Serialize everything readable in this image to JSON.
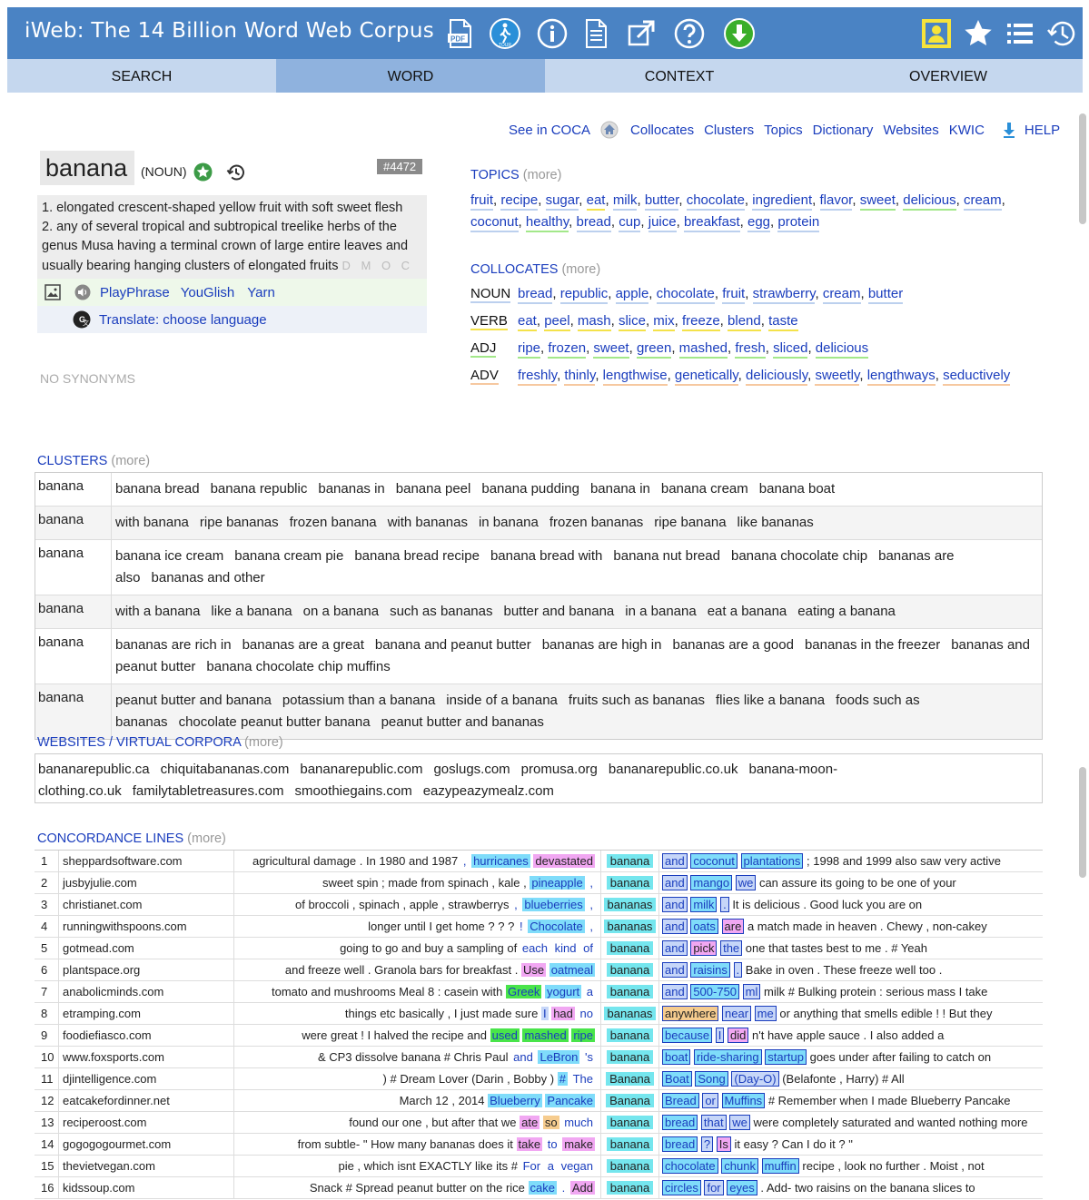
{
  "header": {
    "title": "iWeb: The 14 Billion Word Web Corpus",
    "pdf_label": "PDF",
    "tour_label": "TOUR"
  },
  "tabs": [
    {
      "label": "SEARCH"
    },
    {
      "label": "WORD"
    },
    {
      "label": "CONTEXT"
    },
    {
      "label": "OVERVIEW"
    }
  ],
  "toplinks": {
    "coca": "See in COCA",
    "collocates": "Collocates",
    "clusters": "Clusters",
    "topics": "Topics",
    "dictionary": "Dictionary",
    "websites": "Websites",
    "kwic": "KWIC",
    "help": "HELP"
  },
  "word": {
    "headword": "banana",
    "pos": "(NOUN)",
    "rank": "#4472",
    "def1": "1. elongated crescent-shaped yellow fruit with soft sweet flesh",
    "def2": "2. any of several tropical and subtropical treelike herbs of the genus Musa having a terminal crown of large entire leaves and usually bearing hanging clusters of elongated fruits",
    "dict_letters": "D M O C G",
    "playphrase": "PlayPhrase",
    "youglish": "YouGlish",
    "yarn": "Yarn",
    "translate": "Translate: choose language",
    "no_synonyms": "NO SYNONYMS"
  },
  "topics": {
    "title": "TOPICS",
    "more": "(more)",
    "words": [
      "fruit",
      "recipe",
      "sugar",
      "eat",
      "milk",
      "butter",
      "chocolate",
      "ingredient",
      "flavor",
      "sweet",
      "delicious",
      "cream",
      "coconut",
      "healthy",
      "bread",
      "cup",
      "juice",
      "breakfast",
      "egg",
      "protein"
    ],
    "pos": [
      "n",
      "n",
      "n",
      "v",
      "n",
      "n",
      "n",
      "n",
      "n",
      "j",
      "j",
      "n",
      "n",
      "j",
      "n",
      "n",
      "n",
      "n",
      "n",
      "n"
    ]
  },
  "collocates": {
    "title": "COLLOCATES",
    "more": "(more)",
    "noun_label": "NOUN",
    "noun": [
      "bread",
      "republic",
      "apple",
      "chocolate",
      "fruit",
      "strawberry",
      "cream",
      "butter"
    ],
    "verb_label": "VERB",
    "verb": [
      "eat",
      "peel",
      "mash",
      "slice",
      "mix",
      "freeze",
      "blend",
      "taste"
    ],
    "adj_label": "ADJ",
    "adj": [
      "ripe",
      "frozen",
      "sweet",
      "green",
      "mashed",
      "fresh",
      "sliced",
      "delicious"
    ],
    "adv_label": "ADV",
    "adv": [
      "freshly",
      "thinly",
      "lengthwise",
      "genetically",
      "deliciously",
      "sweetly",
      "lengthways",
      "seductively"
    ]
  },
  "clusters": {
    "title": "CLUSTERS",
    "more": "(more)",
    "rows": [
      {
        "key": "banana",
        "vals": [
          "banana bread",
          "banana republic",
          "bananas in",
          "banana peel",
          "banana pudding",
          "banana in",
          "banana cream",
          "banana boat"
        ]
      },
      {
        "key": "banana",
        "vals": [
          "with banana",
          "ripe bananas",
          "frozen banana",
          "with bananas",
          "in banana",
          "frozen bananas",
          "ripe banana",
          "like bananas"
        ]
      },
      {
        "key": "banana",
        "vals": [
          "banana ice cream",
          "banana cream pie",
          "banana bread recipe",
          "banana bread with",
          "banana nut bread",
          "banana chocolate chip",
          "bananas are also",
          "bananas and other"
        ]
      },
      {
        "key": "banana",
        "vals": [
          "with a banana",
          "like a banana",
          "on a banana",
          "such as bananas",
          "butter and banana",
          "in a banana",
          "eat a banana",
          "eating a banana"
        ]
      },
      {
        "key": "banana",
        "vals": [
          "bananas are rich in",
          "bananas are a great",
          "banana and peanut butter",
          "bananas are high in",
          "bananas are a good",
          "bananas in the freezer",
          "bananas and peanut butter",
          "banana chocolate chip muffins"
        ]
      },
      {
        "key": "banana",
        "vals": [
          "peanut butter and banana",
          "potassium than a banana",
          "inside of a banana",
          "fruits such as bananas",
          "flies like a banana",
          "foods such as bananas",
          "chocolate peanut butter banana",
          "peanut butter and bananas"
        ]
      }
    ]
  },
  "websites": {
    "title": "WEBSITES / VIRTUAL CORPORA",
    "more": "(more)",
    "items": [
      "bananarepublic.ca",
      "chiquitabananas.com",
      "bananarepublic.com",
      "goslugs.com",
      "promusa.org",
      "bananarepublic.co.uk",
      "banana-moon-clothing.co.uk",
      "familytabletreasures.com",
      "smoothiegains.com",
      "eazypeazymealz.com"
    ]
  },
  "concordance": {
    "title": "CONCORDANCE LINES",
    "more": "(more)",
    "rows": [
      {
        "n": "1",
        "src": "sheppardsoftware.com",
        "left_plain": "agricultural damage . In 1980 and 1987",
        "left_tokens": [
          {
            "t": ",",
            "c": "pl"
          },
          {
            "t": "hurricanes",
            "c": "nn"
          },
          {
            "t": "devastated",
            "c": "vb"
          }
        ],
        "kw": "banana",
        "right_tokens": [
          {
            "t": "and",
            "c": "bx"
          },
          {
            "t": "coconut",
            "c": "bx"
          },
          {
            "t": "plantations",
            "c": "bx"
          }
        ],
        "right_plain": "; 1998 and 1999 also saw very active"
      },
      {
        "n": "2",
        "src": "jusbyjulie.com",
        "left_plain": "sweet spin ; made from spinach , kale ,",
        "left_tokens": [
          {
            "t": "pineapple",
            "c": "nn"
          },
          {
            "t": ",",
            "c": "pl"
          }
        ],
        "kw": "banana",
        "right_tokens": [
          {
            "t": "and",
            "c": "bx"
          },
          {
            "t": "mango",
            "c": "bx"
          },
          {
            "t": "we",
            "c": "bx"
          }
        ],
        "right_plain": "can assure its going to be one of your"
      },
      {
        "n": "3",
        "src": "christianet.com",
        "left_plain": "of broccoli , spinach , apple , strawberrys",
        "left_tokens": [
          {
            "t": ",",
            "c": "pl"
          },
          {
            "t": "blueberries",
            "c": "nn"
          },
          {
            "t": ",",
            "c": "pl"
          }
        ],
        "kw": "bananas",
        "right_tokens": [
          {
            "t": "and",
            "c": "bx"
          },
          {
            "t": "milk",
            "c": "bx"
          },
          {
            "t": ".",
            "c": "bx"
          }
        ],
        "right_plain": "It is delicious . Good luck you are on"
      },
      {
        "n": "4",
        "src": "runningwithspoons.com",
        "left_plain": "longer until I get home ? ? ?",
        "left_tokens": [
          {
            "t": "!",
            "c": "pl"
          },
          {
            "t": "Chocolate",
            "c": "nn"
          },
          {
            "t": ",",
            "c": "pl"
          }
        ],
        "kw": "bananas",
        "right_tokens": [
          {
            "t": "and",
            "c": "bx"
          },
          {
            "t": "oats",
            "c": "bx"
          },
          {
            "t": "are",
            "c": "bx"
          }
        ],
        "right_plain": "a match made in heaven . Chewy , non-cakey"
      },
      {
        "n": "5",
        "src": "gotmead.com",
        "left_plain": "going to go and buy a sampling of",
        "left_tokens": [
          {
            "t": "each",
            "c": "pl"
          },
          {
            "t": "kind",
            "c": "pl"
          },
          {
            "t": "of",
            "c": "pl"
          }
        ],
        "kw": "banana",
        "right_tokens": [
          {
            "t": "and",
            "c": "bx"
          },
          {
            "t": "pick",
            "c": "bx"
          },
          {
            "t": "the",
            "c": "bx"
          }
        ],
        "right_plain": "one that tastes best to me . # Yeah"
      },
      {
        "n": "6",
        "src": "plantspace.org",
        "left_plain": "and freeze well . Granola bars for breakfast .",
        "left_tokens": [
          {
            "t": "Use",
            "c": "vb"
          },
          {
            "t": "oatmeal",
            "c": "nn"
          }
        ],
        "kw": "banana",
        "right_tokens": [
          {
            "t": "and",
            "c": "bx"
          },
          {
            "t": "raisins",
            "c": "bx"
          },
          {
            "t": ".",
            "c": "bx"
          }
        ],
        "right_plain": "Bake in oven . These freeze well too ."
      },
      {
        "n": "7",
        "src": "anabolicminds.com",
        "left_plain": "tomato and mushrooms Meal 8 : casein with",
        "left_tokens": [
          {
            "t": "Greek",
            "c": "jj"
          },
          {
            "t": "yogurt",
            "c": "nn"
          },
          {
            "t": "a",
            "c": "pl"
          }
        ],
        "kw": "banana",
        "right_tokens": [
          {
            "t": "and",
            "c": "bx"
          },
          {
            "t": "500-750",
            "c": "bx"
          },
          {
            "t": "ml",
            "c": "bx"
          }
        ],
        "right_plain": "milk # Bulking protein : serious mass I take"
      },
      {
        "n": "8",
        "src": "etramping.com",
        "left_plain": "things etc basically , I just made sure",
        "left_tokens": [
          {
            "t": "I",
            "c": "oth"
          },
          {
            "t": "had",
            "c": "vb"
          },
          {
            "t": "no",
            "c": "pl"
          }
        ],
        "kw": "bananas",
        "right_tokens": [
          {
            "t": "anywhere",
            "c": "bx"
          },
          {
            "t": "near",
            "c": "bx"
          },
          {
            "t": "me",
            "c": "bx"
          }
        ],
        "right_plain": "or anything that smells edible ! ! But they"
      },
      {
        "n": "9",
        "src": "foodiefiasco.com",
        "left_plain": "were great ! I halved the recipe and",
        "left_tokens": [
          {
            "t": "used",
            "c": "jj"
          },
          {
            "t": "mashed",
            "c": "jj"
          },
          {
            "t": "ripe",
            "c": "jj"
          }
        ],
        "kw": "banana",
        "right_tokens": [
          {
            "t": "because",
            "c": "bx"
          },
          {
            "t": "I",
            "c": "bx"
          },
          {
            "t": "did",
            "c": "bx"
          }
        ],
        "right_plain": "n't have apple sauce . I also added a"
      },
      {
        "n": "10",
        "src": "www.foxsports.com",
        "left_plain": "& CP3 dissolve banana # Chris Paul",
        "left_tokens": [
          {
            "t": "and",
            "c": "pl"
          },
          {
            "t": "LeBron",
            "c": "nn"
          },
          {
            "t": "'s",
            "c": "pl"
          }
        ],
        "kw": "banana",
        "right_tokens": [
          {
            "t": "boat",
            "c": "bx"
          },
          {
            "t": "ride-sharing",
            "c": "bx"
          },
          {
            "t": "startup",
            "c": "bx"
          }
        ],
        "right_plain": "goes under after failing to catch on"
      },
      {
        "n": "11",
        "src": "djintelligence.com",
        "left_plain": ") # Dream Lover (Darin , Bobby )",
        "left_tokens": [
          {
            "t": "#",
            "c": "nn"
          },
          {
            "t": "The",
            "c": "pl"
          }
        ],
        "kw": "Banana",
        "right_tokens": [
          {
            "t": "Boat",
            "c": "bx"
          },
          {
            "t": "Song",
            "c": "bx"
          },
          {
            "t": "(Day-O)",
            "c": "bx"
          }
        ],
        "right_plain": "(Belafonte , Harry) # All"
      },
      {
        "n": "12",
        "src": "eatcakefordinner.net",
        "left_plain": "March 12 , 2014",
        "left_tokens": [
          {
            "t": "Blueberry",
            "c": "nn"
          },
          {
            "t": "Pancake",
            "c": "nn"
          }
        ],
        "kw": "Banana",
        "right_tokens": [
          {
            "t": "Bread",
            "c": "bx"
          },
          {
            "t": "or",
            "c": "bx"
          },
          {
            "t": "Muffins",
            "c": "bx"
          }
        ],
        "right_plain": "# Remember when I made Blueberry Pancake"
      },
      {
        "n": "13",
        "src": "reciperoost.com",
        "left_plain": "found our one , but after that we",
        "left_tokens": [
          {
            "t": "ate",
            "c": "vb"
          },
          {
            "t": "so",
            "c": "rb"
          },
          {
            "t": "much",
            "c": "pl"
          }
        ],
        "kw": "banana",
        "right_tokens": [
          {
            "t": "bread",
            "c": "bx"
          },
          {
            "t": "that",
            "c": "bx"
          },
          {
            "t": "we",
            "c": "bx"
          }
        ],
        "right_plain": "were completely saturated and wanted nothing more"
      },
      {
        "n": "14",
        "src": "gogogogourmet.com",
        "left_plain": "from subtle- \" How many bananas does it",
        "left_tokens": [
          {
            "t": "take",
            "c": "vb"
          },
          {
            "t": "to",
            "c": "pl"
          },
          {
            "t": "make",
            "c": "vb"
          }
        ],
        "kw": "banana",
        "right_tokens": [
          {
            "t": "bread",
            "c": "bx"
          },
          {
            "t": "?",
            "c": "bx"
          },
          {
            "t": "Is",
            "c": "bx"
          }
        ],
        "right_plain": "it easy ? Can I do it ? \""
      },
      {
        "n": "15",
        "src": "thevietvegan.com",
        "left_plain": "pie , which isnt EXACTLY like its #",
        "left_tokens": [
          {
            "t": "For",
            "c": "pl"
          },
          {
            "t": "a",
            "c": "pl"
          },
          {
            "t": "vegan",
            "c": "pl"
          }
        ],
        "kw": "banana",
        "right_tokens": [
          {
            "t": "chocolate",
            "c": "bx"
          },
          {
            "t": "chunk",
            "c": "bx"
          },
          {
            "t": "muffin",
            "c": "bx"
          }
        ],
        "right_plain": "recipe , look no further . Moist , not"
      },
      {
        "n": "16",
        "src": "kidssoup.com",
        "left_plain": "Snack # Spread peanut butter on the rice",
        "left_tokens": [
          {
            "t": "cake",
            "c": "nn"
          },
          {
            "t": ".",
            "c": "pl"
          },
          {
            "t": "Add",
            "c": "vb"
          }
        ],
        "kw": "banana",
        "right_tokens": [
          {
            "t": "circles",
            "c": "bx"
          },
          {
            "t": "for",
            "c": "bx"
          },
          {
            "t": "eyes",
            "c": "bx"
          }
        ],
        "right_plain": ". Add- two raisins on the banana slices to"
      }
    ]
  },
  "colors": {
    "header_bg": "#4a83c4",
    "tab_bg": "#c5d7ee",
    "tab_active": "#8fb2de",
    "link": "#1a3dbd",
    "keyword_bg": "#75e6ee"
  },
  "icons": [
    "pdf-icon",
    "tour-icon",
    "info-icon",
    "document-icon",
    "external-link-icon",
    "help-icon",
    "download-icon",
    "user-icon",
    "star-icon",
    "list-icon",
    "history-icon"
  ]
}
